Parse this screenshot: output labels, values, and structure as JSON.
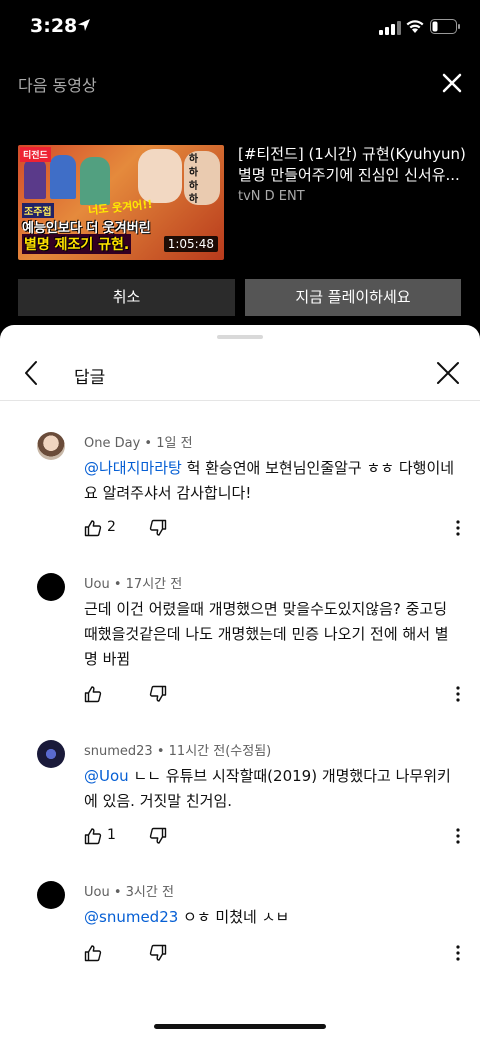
{
  "status_bar": {
    "time": "3:28"
  },
  "next_video": {
    "heading": "다음 동영상",
    "title_line1": "[#티전드] (1시간) 규현(Kyuhyun)",
    "title_line2": "별명 만들어주기에 진심인 신서유...",
    "channel": "tvN D ENT",
    "duration": "1:05:48",
    "thumb_texts": {
      "tag": "티전드",
      "a": "조주접",
      "b": "너도 웃겨어!!",
      "c": "예능인보다 더 웃겨버린",
      "d": "별명 제조기 규현.",
      "e": "하 하 하 하"
    },
    "cancel_label": "취소",
    "play_label": "지금 플레이하세요"
  },
  "replies_panel": {
    "title": "답글",
    "comments": [
      {
        "author": "One Day",
        "time": "• 1일 전",
        "mention": "@나대지마라탕",
        "text": " 헉 환승연애 보현님인줄알구 ㅎㅎ 다행이네요 알려주샤서 감사합니다!",
        "likes": "2"
      },
      {
        "author": "Uou",
        "time": "• 17시간 전",
        "mention": "",
        "text": "근데 이건 어렸을때 개명했으면 맞을수도있지않음? 중고딩때했을것같은데 나도 개명했는데 민증 나오기 전에 해서 별명 바뀜",
        "likes": ""
      },
      {
        "author": "snumed23",
        "time": "• 11시간 전(수정됨)",
        "mention": "@Uou",
        "text": " ㄴㄴ 유튜브 시작할때(2019) 개명했다고 나무위키에 있음. 거짓말 친거임.",
        "likes": "1"
      },
      {
        "author": "Uou",
        "time": "• 3시간 전",
        "mention": "@snumed23",
        "text": " ㅇㅎ 미쳤네 ㅅㅂ",
        "likes": ""
      }
    ]
  }
}
